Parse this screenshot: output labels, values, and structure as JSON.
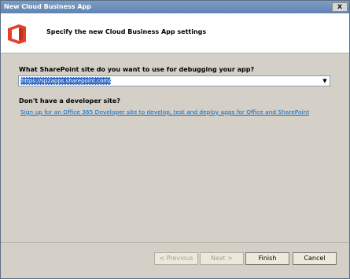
{
  "window": {
    "title": "New Cloud Business App",
    "close_glyph": "x"
  },
  "header": {
    "title": "Specify the new Cloud Business App settings",
    "logo_icon": "office-logo-icon",
    "brand_color": "#e3412c"
  },
  "main": {
    "site_question": "What SharePoint site do you want to use for debugging your app?",
    "site_url": "https://sp2apps.sharepoint.com/",
    "dev_site_question": "Don't have a developer site?",
    "signup_link": "Sign up for an Office 365 Developer site to develop, test and deploy apps for Office and SharePoint"
  },
  "buttons": {
    "previous": "< Previous",
    "next": "Next >",
    "finish": "Finish",
    "cancel": "Cancel"
  }
}
